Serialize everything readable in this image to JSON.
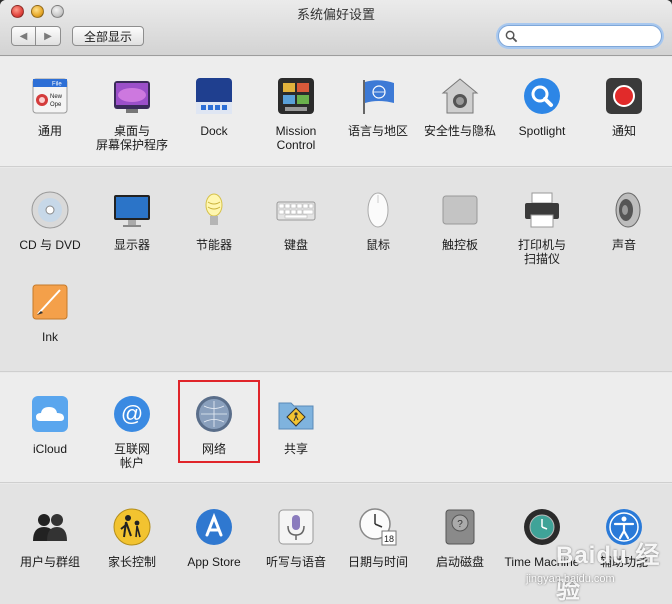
{
  "window": {
    "title": "系统偏好设置",
    "show_all_label": "全部显示",
    "back_glyph": "◀",
    "forward_glyph": "▶",
    "search_placeholder": ""
  },
  "sections": [
    {
      "name": "personal",
      "items": [
        {
          "label": "通用",
          "icon": "general-icon"
        },
        {
          "label": "桌面与\n屏幕保护程序",
          "icon": "desktop-screensaver-icon"
        },
        {
          "label": "Dock",
          "icon": "dock-icon"
        },
        {
          "label": "Mission\nControl",
          "icon": "mission-control-icon"
        },
        {
          "label": "语言与地区",
          "icon": "language-region-icon"
        },
        {
          "label": "安全性与隐私",
          "icon": "security-privacy-icon"
        },
        {
          "label": "Spotlight",
          "icon": "spotlight-icon"
        },
        {
          "label": "通知",
          "icon": "notifications-icon"
        }
      ]
    },
    {
      "name": "hardware",
      "items": [
        {
          "label": "CD 与 DVD",
          "icon": "cd-dvd-icon"
        },
        {
          "label": "显示器",
          "icon": "displays-icon"
        },
        {
          "label": "节能器",
          "icon": "energy-saver-icon"
        },
        {
          "label": "键盘",
          "icon": "keyboard-icon"
        },
        {
          "label": "鼠标",
          "icon": "mouse-icon"
        },
        {
          "label": "触控板",
          "icon": "trackpad-icon"
        },
        {
          "label": "打印机与\n扫描仪",
          "icon": "printer-scanner-icon"
        },
        {
          "label": "声音",
          "icon": "sound-icon"
        },
        {
          "label": "Ink",
          "icon": "ink-icon"
        }
      ]
    },
    {
      "name": "internet",
      "items": [
        {
          "label": "iCloud",
          "icon": "icloud-icon"
        },
        {
          "label": "互联网\n帐户",
          "icon": "internet-accounts-icon"
        },
        {
          "label": "网络",
          "icon": "network-icon"
        },
        {
          "label": "共享",
          "icon": "sharing-icon"
        }
      ]
    },
    {
      "name": "system",
      "items": [
        {
          "label": "用户与群组",
          "icon": "users-groups-icon"
        },
        {
          "label": "家长控制",
          "icon": "parental-controls-icon"
        },
        {
          "label": "App Store",
          "icon": "app-store-icon"
        },
        {
          "label": "听写与语音",
          "icon": "dictation-speech-icon"
        },
        {
          "label": "日期与时间",
          "icon": "date-time-icon"
        },
        {
          "label": "启动磁盘",
          "icon": "startup-disk-icon"
        },
        {
          "label": "Time Machine",
          "icon": "time-machine-icon"
        },
        {
          "label": "辅助功能",
          "icon": "accessibility-icon"
        }
      ]
    }
  ],
  "calendar_day": "18",
  "general_icon_text": {
    "top": "File",
    "bottom": "New",
    "third": "Ope"
  },
  "watermark": {
    "line1": "Baidu 经验",
    "line2": "jingyan.baidu.com"
  },
  "colors": {
    "highlight": "#e0242a",
    "search_focus": "#a8c8ef"
  }
}
